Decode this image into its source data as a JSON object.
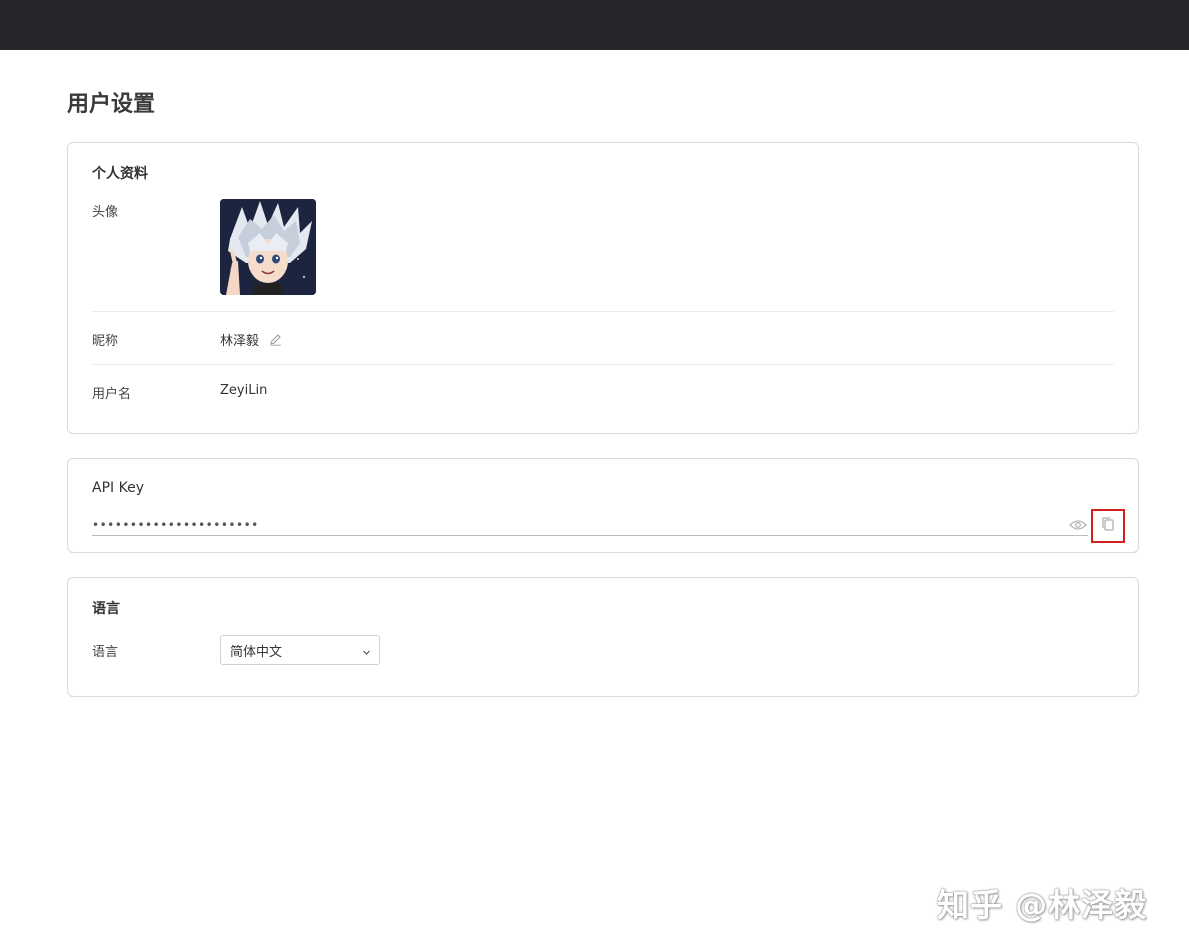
{
  "page": {
    "title": "用户设置"
  },
  "profile": {
    "title": "个人资料",
    "avatar_label": "头像",
    "nickname_label": "昵称",
    "nickname": "林泽毅",
    "username_label": "用户名",
    "username": "ZeyiLin"
  },
  "api": {
    "title": "API Key",
    "masked_value": "••••••••••••••••••••••",
    "icons": {
      "reveal": "eye-icon",
      "copy": "copy-icon"
    },
    "highlight_color": "#d0201f"
  },
  "language": {
    "title": "语言",
    "label": "语言",
    "selected": "简体中文"
  },
  "watermark": {
    "text": "知乎 @林泽毅"
  },
  "colors": {
    "topbar": "#26272b",
    "border": "#d9d9de"
  }
}
